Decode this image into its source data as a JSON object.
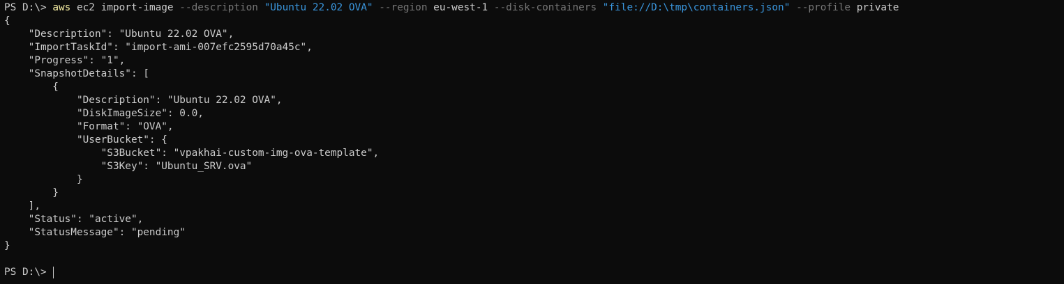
{
  "terminal": {
    "prompt": "PS D:\\> ",
    "command": {
      "executable": "aws",
      "args": [
        {
          "kind": "plain",
          "text": " ec2 import-image "
        },
        {
          "kind": "flag",
          "text": "--description"
        },
        {
          "kind": "plain",
          "text": " "
        },
        {
          "kind": "str",
          "text": "\"Ubuntu 22.02 OVA\""
        },
        {
          "kind": "plain",
          "text": " "
        },
        {
          "kind": "flag",
          "text": "--region"
        },
        {
          "kind": "plain",
          "text": " eu-west-1 "
        },
        {
          "kind": "flag",
          "text": "--disk-containers"
        },
        {
          "kind": "plain",
          "text": " "
        },
        {
          "kind": "str",
          "text": "\"file://D:\\tmp\\containers.json\""
        },
        {
          "kind": "plain",
          "text": " "
        },
        {
          "kind": "flag",
          "text": "--profile"
        },
        {
          "kind": "plain",
          "text": " private"
        }
      ]
    },
    "output_lines": [
      "{",
      "    \"Description\": \"Ubuntu 22.02 OVA\",",
      "    \"ImportTaskId\": \"import-ami-007efc2595d70a45c\",",
      "    \"Progress\": \"1\",",
      "    \"SnapshotDetails\": [",
      "        {",
      "            \"Description\": \"Ubuntu 22.02 OVA\",",
      "            \"DiskImageSize\": 0.0,",
      "            \"Format\": \"OVA\",",
      "            \"UserBucket\": {",
      "                \"S3Bucket\": \"vpakhai-custom-img-ova-template\",",
      "                \"S3Key\": \"Ubuntu_SRV.ova\"",
      "            }",
      "        }",
      "    ],",
      "    \"Status\": \"active\",",
      "    \"StatusMessage\": \"pending\"",
      "}",
      ""
    ],
    "final_prompt": "PS D:\\> "
  },
  "colors": {
    "background": "#0c0c0c",
    "text": "#cccccc",
    "command": "#f9f1a5",
    "flag": "#767676",
    "string": "#3a96dd"
  }
}
